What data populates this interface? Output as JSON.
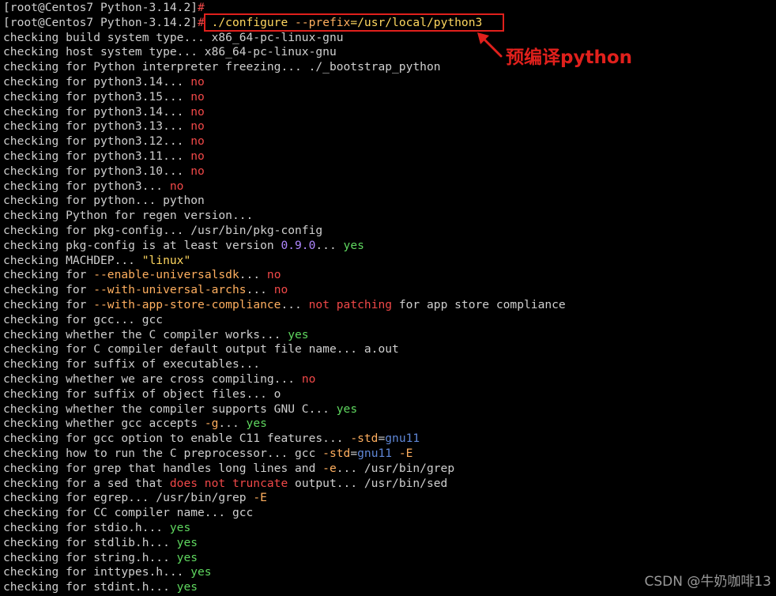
{
  "colors": {
    "default": "#cfcfcf",
    "red": "#f04848",
    "green": "#5fd75f",
    "yellow": "#ffd75f",
    "orange": "#ffaf5f",
    "blue": "#5f87d7",
    "purple": "#af87ff",
    "annotation": "#e0201c",
    "watermark": "#9a9a9a"
  },
  "terminal": {
    "lines": [
      {
        "segments": [
          {
            "t": "[root@Centos7 Python-3.14.2]",
            "c": "default"
          },
          {
            "t": "#",
            "c": "red"
          }
        ]
      },
      {
        "segments": [
          {
            "t": "[root@Centos7 Python-3.14.2]",
            "c": "default"
          },
          {
            "t": "#",
            "c": "red"
          },
          {
            "t": " ./configure ",
            "c": "yellow"
          },
          {
            "t": "--prefix",
            "c": "orange"
          },
          {
            "t": "=/usr/local/python3",
            "c": "yellow"
          }
        ]
      },
      {
        "segments": [
          {
            "t": "checking build system type... x86_64-pc-linux-gnu",
            "c": "default"
          }
        ]
      },
      {
        "segments": [
          {
            "t": "checking host system type... x86_64-pc-linux-gnu",
            "c": "default"
          }
        ]
      },
      {
        "segments": [
          {
            "t": "checking for Python interpreter freezing... ./_bootstrap_python",
            "c": "default"
          }
        ]
      },
      {
        "segments": [
          {
            "t": "checking for python3.14... ",
            "c": "default"
          },
          {
            "t": "no",
            "c": "red"
          }
        ]
      },
      {
        "segments": [
          {
            "t": "checking for python3.15... ",
            "c": "default"
          },
          {
            "t": "no",
            "c": "red"
          }
        ]
      },
      {
        "segments": [
          {
            "t": "checking for python3.14... ",
            "c": "default"
          },
          {
            "t": "no",
            "c": "red"
          }
        ]
      },
      {
        "segments": [
          {
            "t": "checking for python3.13... ",
            "c": "default"
          },
          {
            "t": "no",
            "c": "red"
          }
        ]
      },
      {
        "segments": [
          {
            "t": "checking for python3.12... ",
            "c": "default"
          },
          {
            "t": "no",
            "c": "red"
          }
        ]
      },
      {
        "segments": [
          {
            "t": "checking for python3.11... ",
            "c": "default"
          },
          {
            "t": "no",
            "c": "red"
          }
        ]
      },
      {
        "segments": [
          {
            "t": "checking for python3.10... ",
            "c": "default"
          },
          {
            "t": "no",
            "c": "red"
          }
        ]
      },
      {
        "segments": [
          {
            "t": "checking for python3... ",
            "c": "default"
          },
          {
            "t": "no",
            "c": "red"
          }
        ]
      },
      {
        "segments": [
          {
            "t": "checking for python... python",
            "c": "default"
          }
        ]
      },
      {
        "segments": [
          {
            "t": "checking Python for regen version...",
            "c": "default"
          }
        ]
      },
      {
        "segments": [
          {
            "t": "checking for pkg-config... /usr/bin/pkg-config",
            "c": "default"
          }
        ]
      },
      {
        "segments": [
          {
            "t": "checking pkg-config is at least version ",
            "c": "default"
          },
          {
            "t": "0.9.0",
            "c": "purple"
          },
          {
            "t": "... ",
            "c": "default"
          },
          {
            "t": "yes",
            "c": "green"
          }
        ]
      },
      {
        "segments": [
          {
            "t": "checking MACHDEP... ",
            "c": "default"
          },
          {
            "t": "\"linux\"",
            "c": "yellow"
          }
        ]
      },
      {
        "segments": [
          {
            "t": "checking for ",
            "c": "default"
          },
          {
            "t": "--enable-universalsdk",
            "c": "orange"
          },
          {
            "t": "... ",
            "c": "default"
          },
          {
            "t": "no",
            "c": "red"
          }
        ]
      },
      {
        "segments": [
          {
            "t": "checking for ",
            "c": "default"
          },
          {
            "t": "--with-universal-archs",
            "c": "orange"
          },
          {
            "t": "... ",
            "c": "default"
          },
          {
            "t": "no",
            "c": "red"
          }
        ]
      },
      {
        "segments": [
          {
            "t": "checking for ",
            "c": "default"
          },
          {
            "t": "--with-app-store-compliance",
            "c": "orange"
          },
          {
            "t": "... ",
            "c": "default"
          },
          {
            "t": "not patching",
            "c": "red"
          },
          {
            "t": " for app store compliance",
            "c": "default"
          }
        ]
      },
      {
        "segments": [
          {
            "t": "checking for gcc... gcc",
            "c": "default"
          }
        ]
      },
      {
        "segments": [
          {
            "t": "checking whether the C compiler works... ",
            "c": "default"
          },
          {
            "t": "yes",
            "c": "green"
          }
        ]
      },
      {
        "segments": [
          {
            "t": "checking for C compiler default output file name... a.out",
            "c": "default"
          }
        ]
      },
      {
        "segments": [
          {
            "t": "checking for suffix of executables...",
            "c": "default"
          }
        ]
      },
      {
        "segments": [
          {
            "t": "checking whether we are cross compiling... ",
            "c": "default"
          },
          {
            "t": "no",
            "c": "red"
          }
        ]
      },
      {
        "segments": [
          {
            "t": "checking for suffix of object files... o",
            "c": "default"
          }
        ]
      },
      {
        "segments": [
          {
            "t": "checking whether the compiler supports GNU C... ",
            "c": "default"
          },
          {
            "t": "yes",
            "c": "green"
          }
        ]
      },
      {
        "segments": [
          {
            "t": "checking whether gcc accepts ",
            "c": "default"
          },
          {
            "t": "-g",
            "c": "orange"
          },
          {
            "t": "... ",
            "c": "default"
          },
          {
            "t": "yes",
            "c": "green"
          }
        ]
      },
      {
        "segments": [
          {
            "t": "checking for gcc option to enable C11 features... ",
            "c": "default"
          },
          {
            "t": "-std",
            "c": "orange"
          },
          {
            "t": "=",
            "c": "default"
          },
          {
            "t": "gnu11",
            "c": "blue"
          }
        ]
      },
      {
        "segments": [
          {
            "t": "checking how to run the C preprocessor... gcc ",
            "c": "default"
          },
          {
            "t": "-std",
            "c": "orange"
          },
          {
            "t": "=",
            "c": "default"
          },
          {
            "t": "gnu11",
            "c": "blue"
          },
          {
            "t": " ",
            "c": "default"
          },
          {
            "t": "-E",
            "c": "orange"
          }
        ]
      },
      {
        "segments": [
          {
            "t": "checking for grep that handles long lines and ",
            "c": "default"
          },
          {
            "t": "-e",
            "c": "orange"
          },
          {
            "t": "... /usr/bin/grep",
            "c": "default"
          }
        ]
      },
      {
        "segments": [
          {
            "t": "checking for a sed that ",
            "c": "default"
          },
          {
            "t": "does not truncate",
            "c": "red"
          },
          {
            "t": " output... /usr/bin/sed",
            "c": "default"
          }
        ]
      },
      {
        "segments": [
          {
            "t": "checking for egrep... /usr/bin/grep ",
            "c": "default"
          },
          {
            "t": "-E",
            "c": "orange"
          }
        ]
      },
      {
        "segments": [
          {
            "t": "checking for CC compiler name... gcc",
            "c": "default"
          }
        ]
      },
      {
        "segments": [
          {
            "t": "checking for stdio.h... ",
            "c": "default"
          },
          {
            "t": "yes",
            "c": "green"
          }
        ]
      },
      {
        "segments": [
          {
            "t": "checking for stdlib.h... ",
            "c": "default"
          },
          {
            "t": "yes",
            "c": "green"
          }
        ]
      },
      {
        "segments": [
          {
            "t": "checking for string.h... ",
            "c": "default"
          },
          {
            "t": "yes",
            "c": "green"
          }
        ]
      },
      {
        "segments": [
          {
            "t": "checking for inttypes.h... ",
            "c": "default"
          },
          {
            "t": "yes",
            "c": "green"
          }
        ]
      },
      {
        "segments": [
          {
            "t": "checking for stdint.h... ",
            "c": "default"
          },
          {
            "t": "yes",
            "c": "green"
          }
        ]
      }
    ]
  },
  "annotation": {
    "label": "预编译python",
    "arrow_icon": "arrow-up-left-icon"
  },
  "watermark": {
    "text": "CSDN @牛奶咖啡13"
  }
}
